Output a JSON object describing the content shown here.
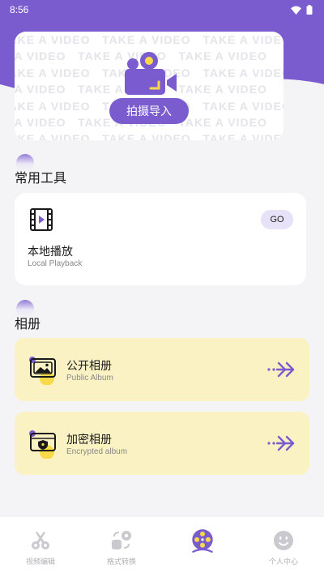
{
  "status_bar": {
    "time": "8:56",
    "wifi_icon": "wifi-icon",
    "battery_icon": "battery-icon"
  },
  "colors": {
    "accent": "#7b5ccf",
    "album_bg": "#fbf2c4",
    "page_bg": "#f4f4f6",
    "highlight_yellow": "#f7d94a"
  },
  "hero": {
    "watermark_text": "TAKE A VIDEO",
    "camera_icon": "video-camera-icon",
    "shoot_button_label": "拍摄导入"
  },
  "tools_section": {
    "title": "常用工具",
    "local_playback": {
      "icon": "film-icon",
      "go_label": "GO",
      "title": "本地播放",
      "subtitle": "Local Playback"
    }
  },
  "album_section": {
    "title": "相册",
    "items": [
      {
        "icon": "photo-album-icon",
        "title": "公开相册",
        "subtitle": "Public Album",
        "arrow": "double-chevron-right-icon"
      },
      {
        "icon": "locked-album-icon",
        "title": "加密相册",
        "subtitle": "Encrypted album",
        "arrow": "double-chevron-right-icon"
      }
    ]
  },
  "tabbar": {
    "tabs": [
      {
        "label": "视频编辑",
        "icon": "scissors-icon",
        "active": false
      },
      {
        "label": "格式转换",
        "icon": "convert-icon",
        "active": false
      },
      {
        "label": "",
        "icon": "film-reel-icon",
        "active": true
      },
      {
        "label": "个人中心",
        "icon": "smiley-icon",
        "active": false
      }
    ]
  }
}
